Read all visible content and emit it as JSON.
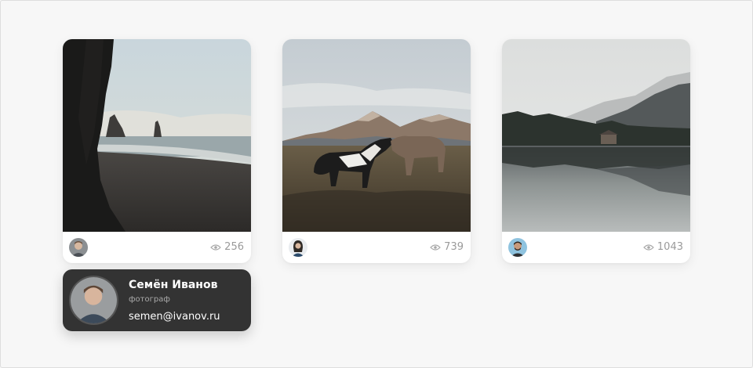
{
  "cards": [
    {
      "photo": "beach-with-sea-stacks",
      "avatar": "man-avatar",
      "views": "256"
    },
    {
      "photo": "horses-in-mountain-field",
      "avatar": "woman-avatar",
      "views": "739"
    },
    {
      "photo": "misty-lake-with-forest",
      "avatar": "bearded-man-avatar",
      "views": "1043"
    }
  ],
  "profile": {
    "name": "Семён Иванов",
    "role": "фотограф",
    "email": "semen@ivanov.ru"
  },
  "icons": {
    "views": "eye-icon"
  },
  "colors": {
    "background": "#f7f7f7",
    "card": "#ffffff",
    "profile_bg": "#333333",
    "muted_text": "#9a9a9a",
    "profile_role": "#a9a9a9"
  }
}
